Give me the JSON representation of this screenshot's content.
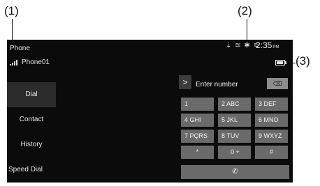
{
  "callouts": {
    "one": "(1)",
    "two": "(2)",
    "three": "(3)"
  },
  "header": {
    "app_title": "Phone",
    "device_name": "Phone01",
    "status_icons": "⇣ ≋ ✱ ⚟",
    "time": "2:35",
    "time_suffix": "PM",
    "battery_level": 0.9
  },
  "menu": [
    {
      "label": "Dial"
    },
    {
      "label": "Contact"
    },
    {
      "label": "History"
    },
    {
      "label": "Speed Dial"
    }
  ],
  "dialer": {
    "arrow": ">",
    "placeholder": "Enter number",
    "backspace": "⌫",
    "call_symbol": "✆"
  },
  "keypad": [
    {
      "digit": "1",
      "letters": ""
    },
    {
      "digit": "2",
      "letters": "ABC"
    },
    {
      "digit": "3",
      "letters": "DEF"
    },
    {
      "digit": "4",
      "letters": "GHI"
    },
    {
      "digit": "5",
      "letters": "JKL"
    },
    {
      "digit": "6",
      "letters": "MNO"
    },
    {
      "digit": "7",
      "letters": "PQRS"
    },
    {
      "digit": "8",
      "letters": "TUV"
    },
    {
      "digit": "9",
      "letters": "WXYZ"
    },
    {
      "digit": "*",
      "letters": ""
    },
    {
      "digit": "0",
      "letters": "+"
    },
    {
      "digit": "#",
      "letters": ""
    }
  ]
}
